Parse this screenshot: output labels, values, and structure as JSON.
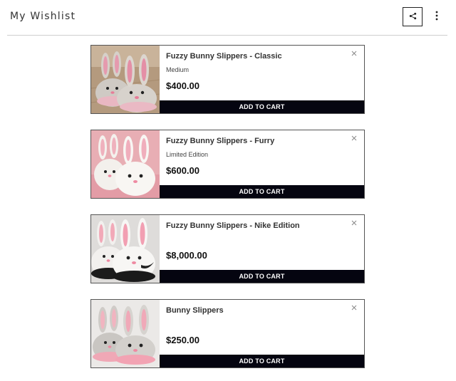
{
  "header": {
    "title": "My Wishlist",
    "share_icon": "share-icon",
    "more_icon": "more-vertical-icon"
  },
  "items": [
    {
      "name": "Fuzzy Bunny Slippers - Classic",
      "variant": "Medium",
      "price": "$400.00",
      "cart_label": "ADD TO CART",
      "image": "grey bunny slippers on wood floor"
    },
    {
      "name": "Fuzzy Bunny Slippers - Furry",
      "variant": "Limited Edition",
      "price": "$600.00",
      "cart_label": "ADD TO CART",
      "image": "white furry bunny slippers on pink"
    },
    {
      "name": "Fuzzy Bunny Slippers - Nike Edition",
      "variant": "",
      "price": "$8,000.00",
      "cart_label": "ADD TO CART",
      "image": "white bunny slippers with swoosh"
    },
    {
      "name": "Bunny Slippers",
      "variant": "",
      "price": "$250.00",
      "cart_label": "ADD TO CART",
      "image": "grey and pink bunny slippers"
    }
  ],
  "colors": {
    "button_bg": "#050510",
    "border": "#555555",
    "divider": "#cfcfcf"
  }
}
